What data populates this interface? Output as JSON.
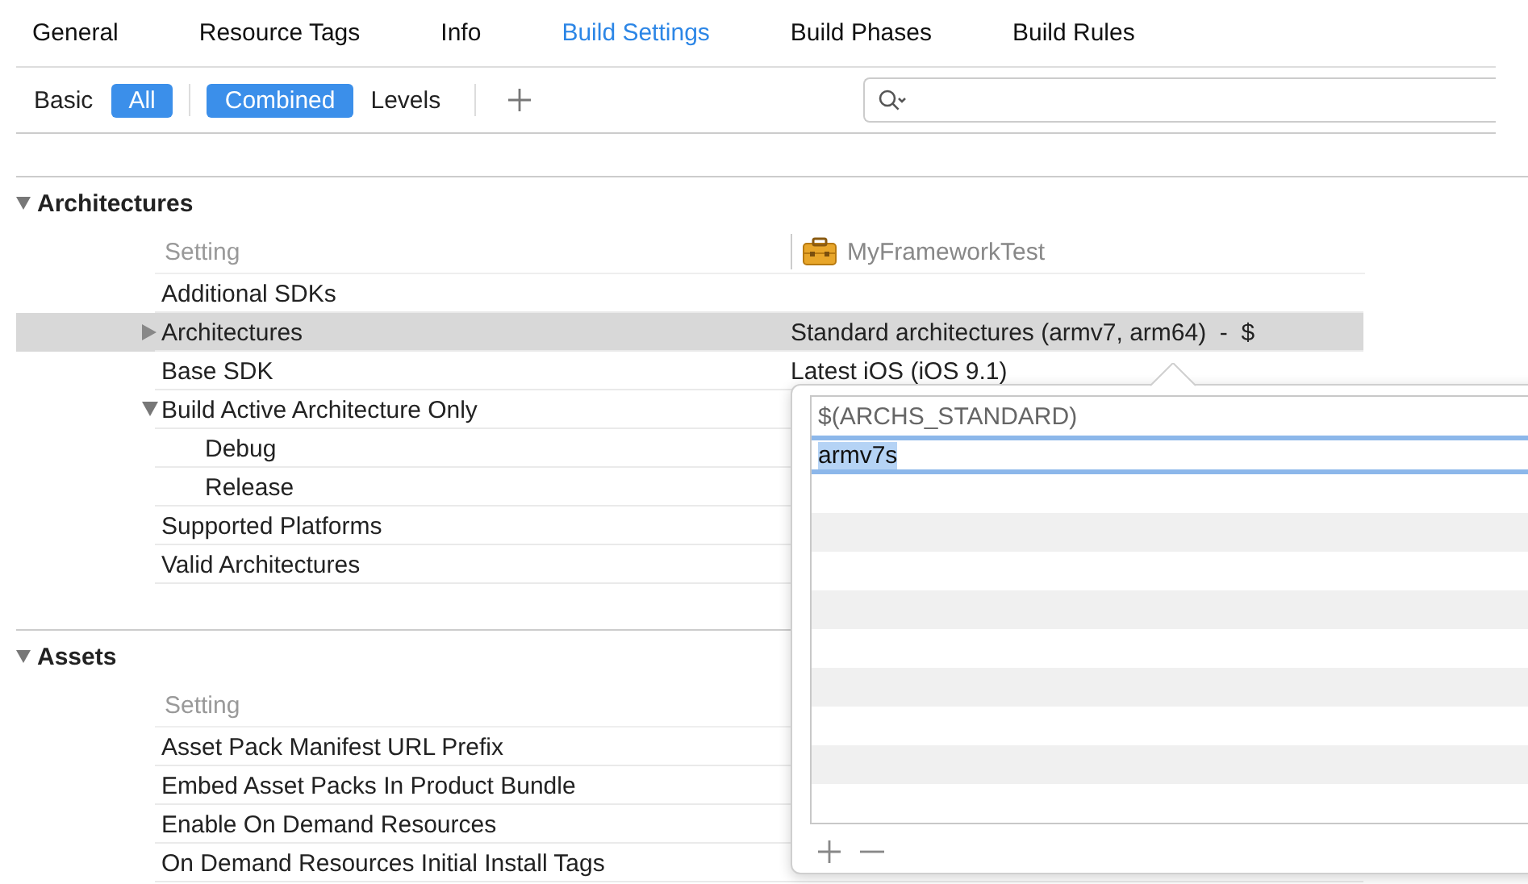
{
  "tabs": [
    {
      "label": "General",
      "selected": false
    },
    {
      "label": "Resource Tags",
      "selected": false
    },
    {
      "label": "Info",
      "selected": false
    },
    {
      "label": "Build Settings",
      "selected": true
    },
    {
      "label": "Build Phases",
      "selected": false
    },
    {
      "label": "Build Rules",
      "selected": false
    }
  ],
  "scope_filter": [
    {
      "label": "Basic",
      "selected": false
    },
    {
      "label": "All",
      "selected": true
    }
  ],
  "view_filter": [
    {
      "label": "Combined",
      "selected": true
    },
    {
      "label": "Levels",
      "selected": false
    }
  ],
  "sections": [
    {
      "title": "Architectures",
      "expanded": true,
      "column_header": "Setting",
      "target": "MyFrameworkTest",
      "rows": [
        {
          "label": "Additional SDKs",
          "selected": false
        },
        {
          "label": "Architectures",
          "selected": true,
          "expanded": false,
          "value": "Standard architectures (armv7, arm64)  -  $"
        },
        {
          "label": "Base SDK",
          "selected": false,
          "value": "Latest iOS (iOS 9.1)"
        },
        {
          "label": "Build Active Architecture Only",
          "selected": false,
          "expanded": true,
          "children": [
            {
              "label": "Debug",
              "selected": false
            },
            {
              "label": "Release",
              "selected": false
            }
          ]
        },
        {
          "label": "Supported Platforms",
          "selected": false
        },
        {
          "label": "Valid Architectures",
          "selected": false
        }
      ]
    },
    {
      "title": "Assets",
      "expanded": true,
      "column_header": "Setting",
      "rows": [
        {
          "label": "Asset Pack Manifest URL Prefix",
          "selected": false
        },
        {
          "label": "Embed Asset Packs In Product Bundle",
          "selected": false
        },
        {
          "label": "Enable On Demand Resources",
          "selected": false
        },
        {
          "label": "On Demand Resources Initial Install Tags",
          "selected": false
        }
      ]
    }
  ],
  "popover": {
    "items": [
      {
        "text": "$(ARCHS_STANDARD)",
        "selected": false
      },
      {
        "text": "armv7s",
        "selected": true
      }
    ]
  }
}
